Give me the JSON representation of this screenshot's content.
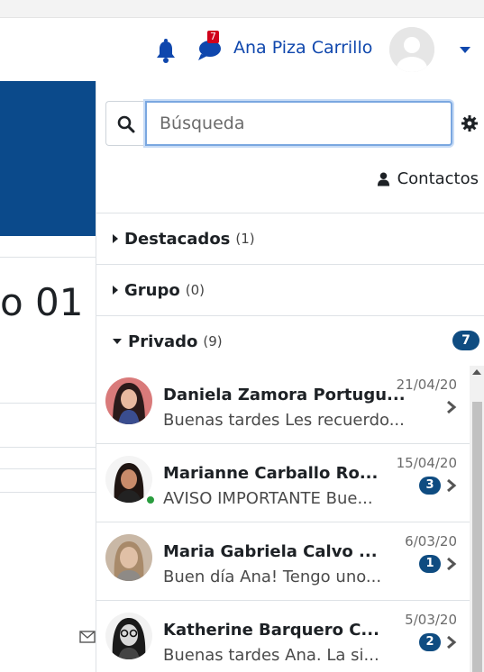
{
  "header": {
    "user_name": "Ana Piza Carrillo",
    "message_badge": "7",
    "icons": {
      "notifications": "bell-icon",
      "messages": "chat-icon",
      "user_menu": "caret-down-icon"
    },
    "accent_color": "#0f47ad",
    "badge_color": "#d0021b"
  },
  "background_page": {
    "partial_title": "o 01"
  },
  "drawer": {
    "search": {
      "placeholder": "Búsqueda",
      "value": ""
    },
    "contacts_label": "Contactos",
    "sections": [
      {
        "name": "Destacados",
        "count": "(1)",
        "expanded": false
      },
      {
        "name": "Grupo",
        "count": "(0)",
        "expanded": false
      },
      {
        "name": "Privado",
        "count": "(9)",
        "expanded": true,
        "unread": "7"
      }
    ],
    "messages": [
      {
        "name": "Daniela Zamora Portugu...",
        "date": "21/04/20",
        "preview": "Buenas tardes Les recuerdo...",
        "unread": "",
        "online": false
      },
      {
        "name": "Marianne Carballo Ro...",
        "date": "15/04/20",
        "preview": "AVISO IMPORTANTE Bue...",
        "unread": "3",
        "online": true
      },
      {
        "name": "Maria Gabriela Calvo ...",
        "date": "6/03/20",
        "preview": "Buen día Ana! Tengo uno...",
        "unread": "1",
        "online": false
      },
      {
        "name": "Katherine Barquero C...",
        "date": "5/03/20",
        "preview": "Buenas tardes Ana. La si...",
        "unread": "2",
        "online": false
      }
    ],
    "badge_color": "#0f4c81"
  }
}
